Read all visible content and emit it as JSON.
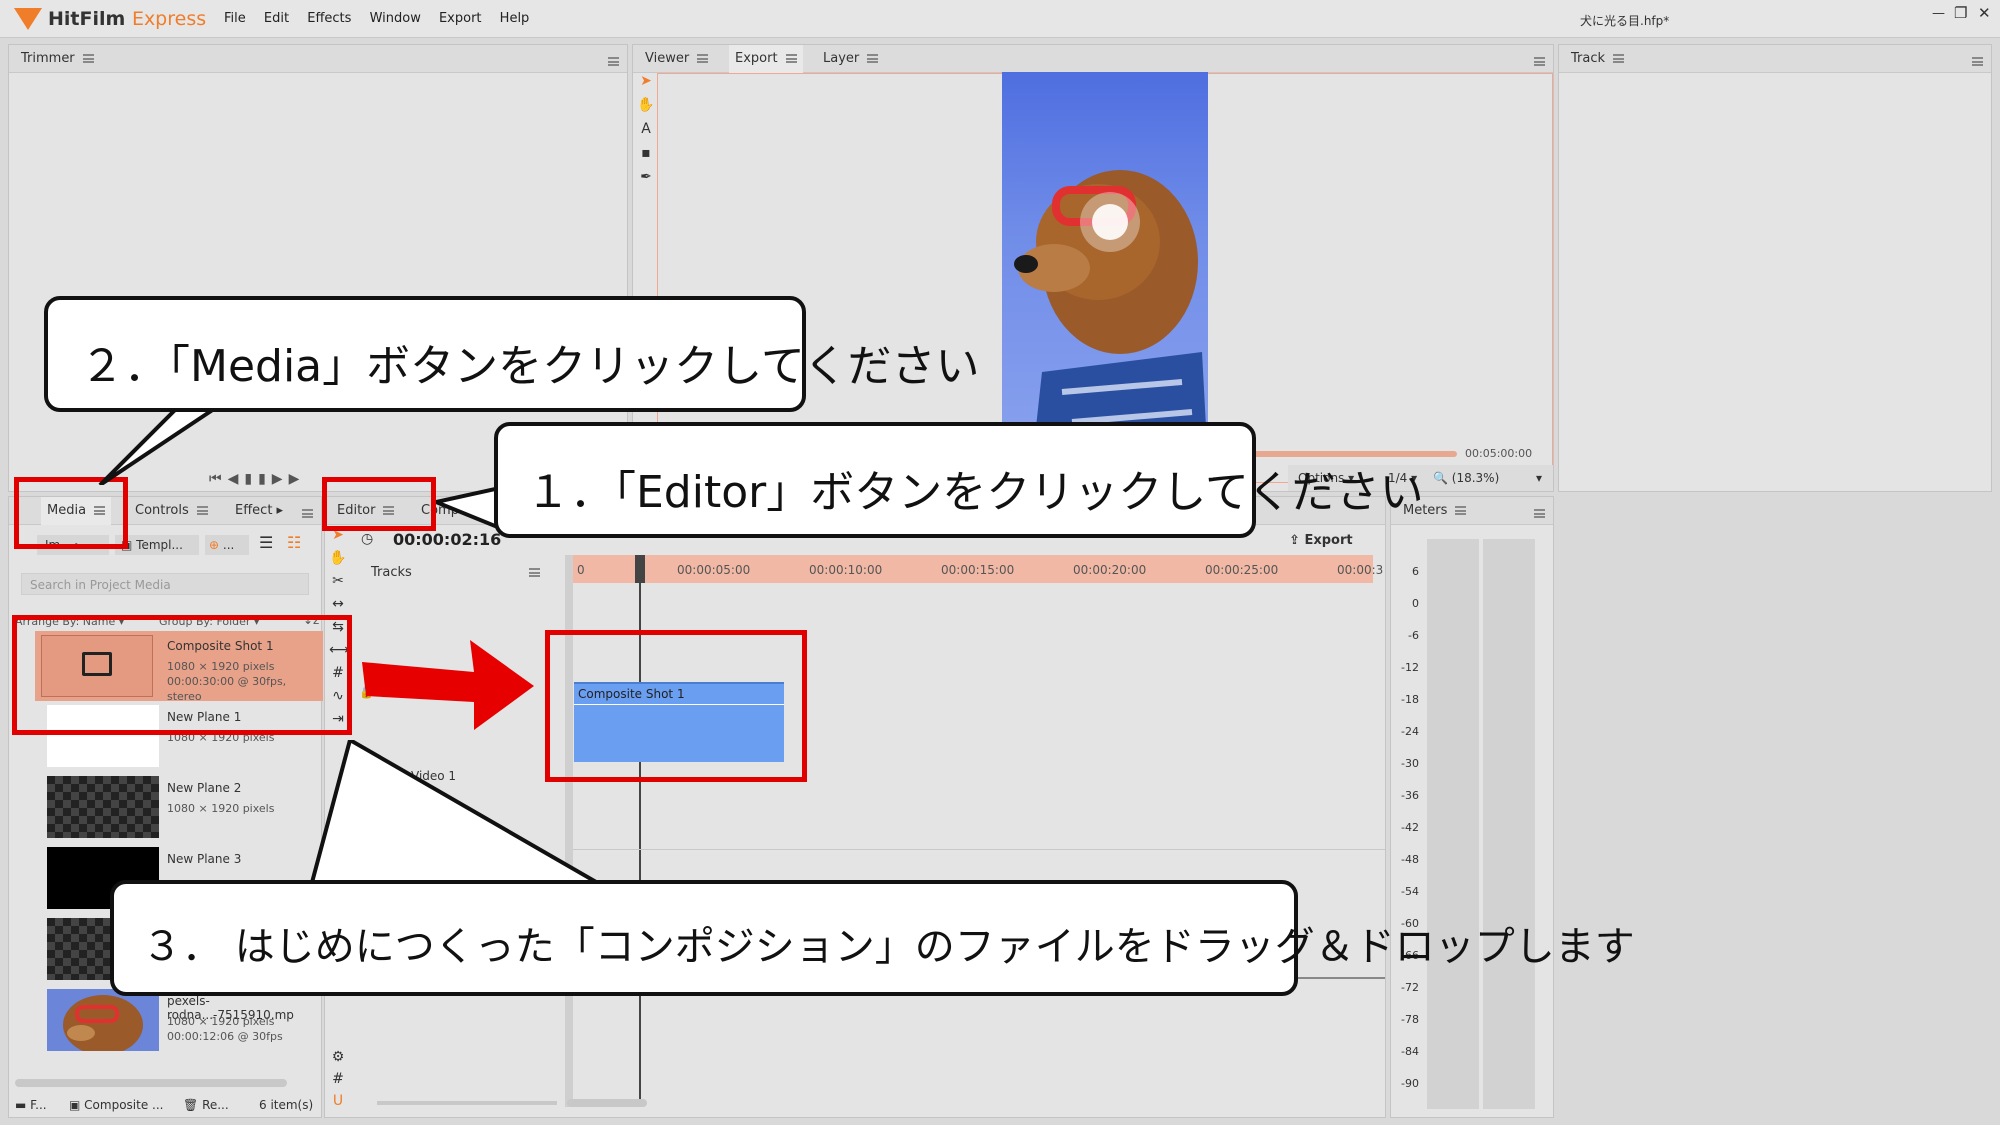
{
  "app": {
    "name_part1": "HitFilm",
    "name_part2": "Express",
    "project_title": "犬に光る目.hfp*",
    "colors": {
      "accent": "#f07d2a",
      "callout_red": "#e00000",
      "clip_blue": "#6a9ef0",
      "selected_row": "#e8a28a"
    }
  },
  "menu": [
    "File",
    "Edit",
    "Effects",
    "Window",
    "Export",
    "Help"
  ],
  "window_controls": {
    "minimize": "—",
    "restore": "❐",
    "close": "✕"
  },
  "trimmer": {
    "tab": "Trimmer"
  },
  "viewer": {
    "tabs": [
      "Viewer",
      "Export",
      "Layer"
    ],
    "tools": [
      "select-arrow-icon",
      "hand-icon",
      "text-icon",
      "rectangle-icon",
      "pen-icon"
    ],
    "time_end": "00:05:00:00",
    "options_label": "Options",
    "resolution": "1/4",
    "zoom": "(18.3%)"
  },
  "track_panel": {
    "tab": "Track"
  },
  "media_panel": {
    "tabs": [
      "Media",
      "Controls",
      "Effect"
    ],
    "import_label": "Im...",
    "templates_label": "Templ...",
    "new_label": "...",
    "search_placeholder": "Search in Project Media",
    "arrange_by": "Arrange By: Name",
    "group_by": "Group By: Folder",
    "items": [
      {
        "title": "Composite Shot 1",
        "line1": "1080 × 1920 pixels",
        "line2": "00:00:30:00 @ 30fps, stereo",
        "thumb": "composite"
      },
      {
        "title": "New Plane 1",
        "line1": "1080 × 1920 pixels",
        "line2": "",
        "thumb": "white"
      },
      {
        "title": "New Plane 2",
        "line1": "1080 × 1920 pixels",
        "line2": "",
        "thumb": "checker"
      },
      {
        "title": "New Plane 3",
        "line1": "",
        "line2": "",
        "thumb": "black"
      },
      {
        "title": "",
        "line1": "",
        "line2": "",
        "thumb": "checker"
      },
      {
        "title": "pexels-rodna...-7515910.mp",
        "line1": "1080 × 1920 pixels",
        "line2": "00:00:12:06 @ 30fps",
        "thumb": "dog"
      }
    ],
    "footer": {
      "folder": "F...",
      "composite": "Composite ...",
      "remove": "Re...",
      "count": "6 item(s)"
    }
  },
  "editor": {
    "tabs": [
      "Editor",
      "Composi..."
    ],
    "timecode": "00:00:02:16",
    "tracks_label": "Tracks",
    "export_label": "Export",
    "ruler": [
      "0",
      "00:00:05:00",
      "00:00:10:00",
      "00:00:15:00",
      "00:00:20:00",
      "00:00:25:00",
      "00:00:3"
    ],
    "clip_label": "Composite Shot 1",
    "video_track": "Video 1"
  },
  "meters": {
    "tab": "Meters",
    "scale": [
      "6",
      "0",
      "-6",
      "-12",
      "-18",
      "-24",
      "-30",
      "-36",
      "-42",
      "-48",
      "-54",
      "-60",
      "-66",
      "-72",
      "-78",
      "-84",
      "-90"
    ]
  },
  "callouts": {
    "step1": "１．「Editor」ボタンをクリックしてください",
    "step2": "２．「Media」ボタンをクリックしてください",
    "step3": "３．  はじめにつくった「コンポジション」のファイルをドラッグ＆ドロップします"
  }
}
